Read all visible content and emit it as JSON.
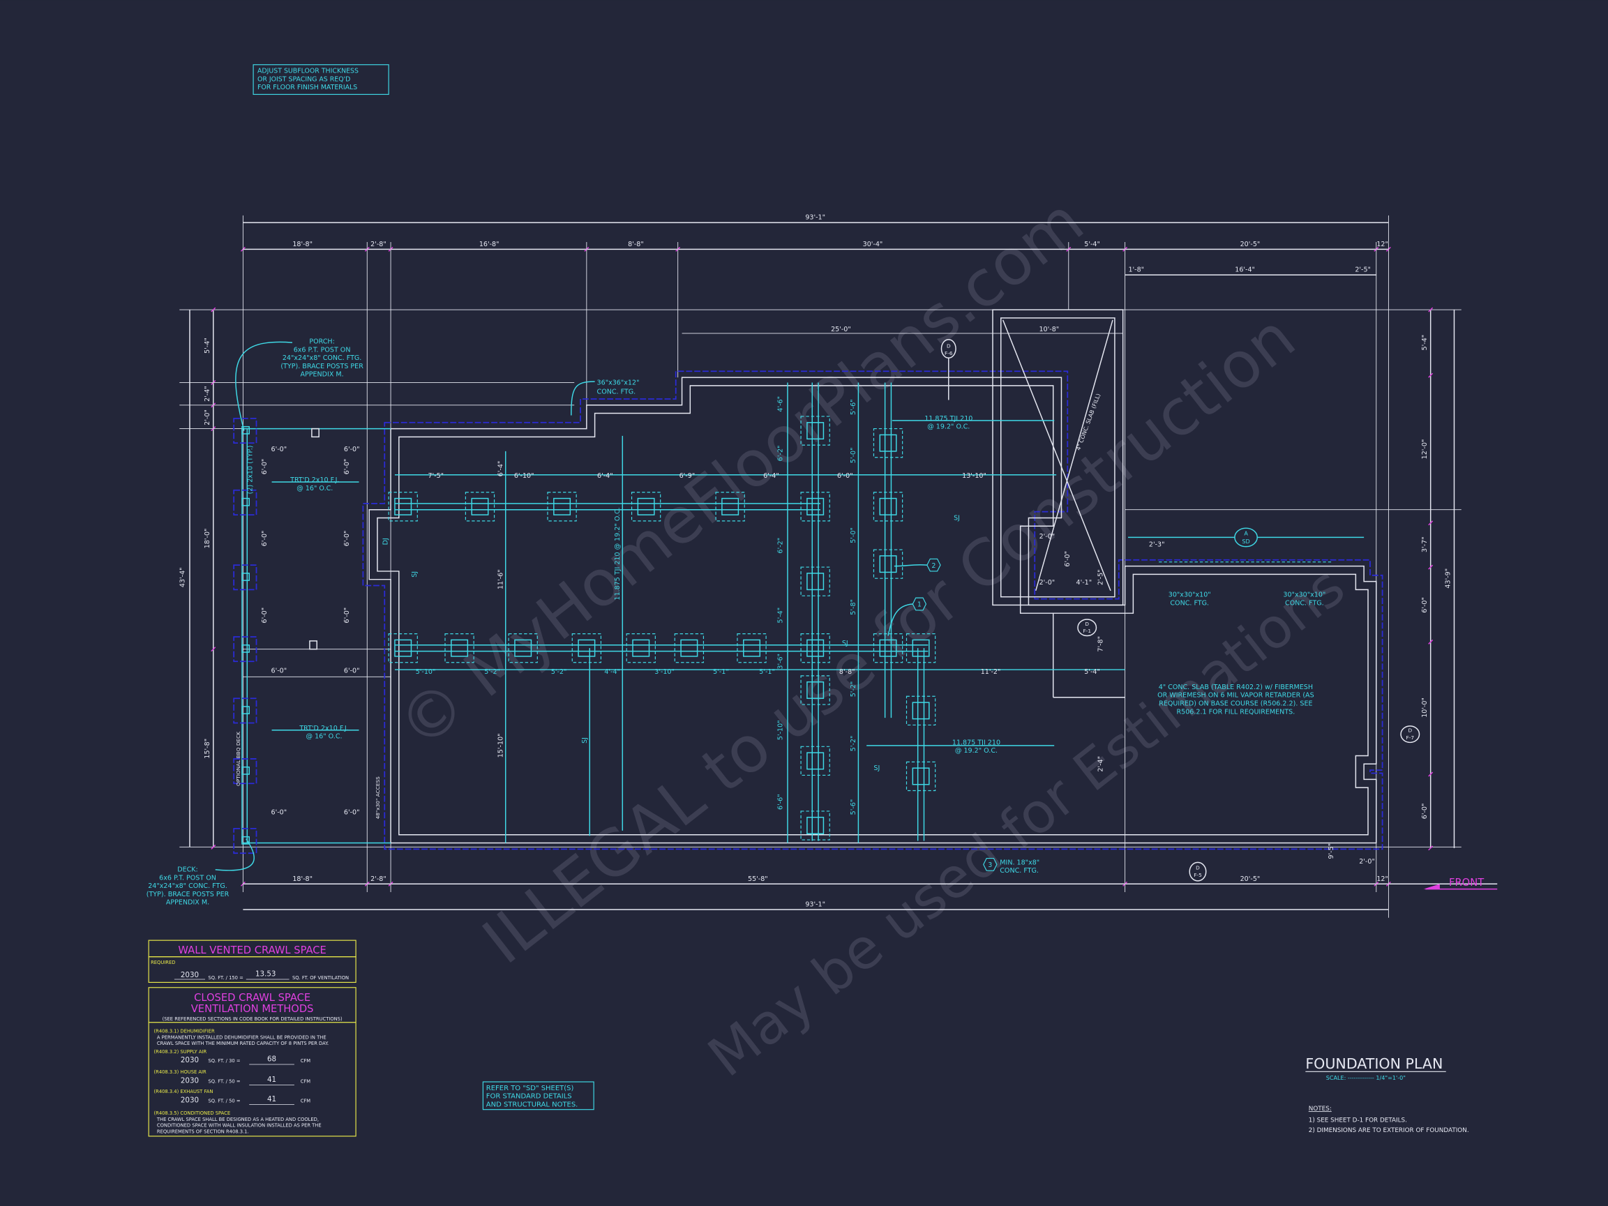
{
  "colors": {
    "background": "#232639",
    "walls": "#e6e8f2",
    "framing": "#3fd9e6",
    "footing_dashed": "#2b2bd6",
    "table_border": "#e8e84a",
    "table_title": "#e040e0",
    "front_arrow": "#e040e0"
  },
  "title": {
    "main": "FOUNDATION PLAN",
    "scale": "SCALE: ------------- 1/4\"=1'-0\""
  },
  "notes": {
    "heading": "NOTES:",
    "items": [
      "1) SEE SHEET D-1 FOR DETAILS.",
      "2) DIMENSIONS ARE TO EXTERIOR OF FOUNDATION."
    ]
  },
  "subfloor_note": [
    "ADJUST SUBFLOOR THICKNESS",
    "OR JOIST SPACING AS REQ'D",
    "FOR FLOOR FINISH MATERIALS"
  ],
  "refer_note": [
    "REFER TO \"SD\" SHEET(S)",
    "FOR STANDARD DETAILS",
    "AND STRUCTURAL NOTES."
  ],
  "porch_note": [
    "PORCH:",
    "6x6 P.T. POST ON",
    "24\"x24\"x8\" CONC. FTG.",
    "(TYP). BRACE POSTS PER",
    "APPENDIX M."
  ],
  "deck_note": [
    "DECK:",
    "6x6 P.T. POST ON",
    "24\"x24\"x8\" CONC. FTG.",
    "(TYP). BRACE POSTS PER",
    "APPENDIX M."
  ],
  "slab_note": [
    "4\" CONC. SLAB (TABLE R402.2) w/ FIBERMESH",
    "OR WIREMESH ON 6 MIL VAPOR RETARDER (AS",
    "REQUIRED) ON BASE COURSE (R506.2.2). SEE",
    "R506.2.1 FOR FILL REQUIREMENTS."
  ],
  "footing_labels": {
    "conc36": [
      "36\"x36\"x12\"",
      "CONC. FTG."
    ],
    "conc30a": [
      "30\"x30\"x10\"",
      "CONC. FTG."
    ],
    "conc30b": [
      "30\"x30\"x10\"",
      "CONC. FTG."
    ],
    "min18": [
      "MIN. 18\"x8\"",
      "CONC. FTG."
    ],
    "min18_tag": "3"
  },
  "framing_labels": {
    "tji_1": [
      "11.875 TJI 210",
      "@ 19.2\" O.C."
    ],
    "tji_2": [
      "11.875 TJI 210",
      "@ 19.2\" O.C."
    ],
    "tji_3": "11.875 TJI 210 @ 19.2\" O.C.",
    "trtd_1": [
      "TRT'D 2x10 F.J.",
      "@ 16\" O.C."
    ],
    "trtd_2": [
      "TRT'D 2x10 F.J.",
      "@ 16\" O.C."
    ],
    "sj": "SJ",
    "dj": "DJ",
    "beam": "(2) 2x10 (TYP.)",
    "bbq": "OPTIONAL BBQ DECK",
    "access": "48\"x30\" ACCESS",
    "slab_fill": "4\" CONC. SLAB (FILL)",
    "callout_1": "1",
    "callout_2": "2"
  },
  "section_markers": {
    "top": [
      "D",
      "F-6"
    ],
    "right": [
      "D",
      "F-7"
    ],
    "mid": [
      "D",
      "F-1"
    ],
    "bottom": [
      "D",
      "F-5"
    ],
    "garage": [
      "A",
      "SD"
    ]
  },
  "front_label": "FRONT",
  "dimensions": {
    "top_overall": "93'-1\"",
    "top_row": [
      "18'-8\"",
      "2'-8\"",
      "16'-8\"",
      "8'-8\"",
      "30'-4\"",
      "5'-4\"",
      "20'-5\"",
      "12\""
    ],
    "top_garage": [
      "1'-8\"",
      "16'-4\"",
      "2'-5\""
    ],
    "bottom_row": [
      "18'-8\"",
      "2'-8\"",
      "55'-8\"",
      "20'-5\"",
      "12\""
    ],
    "bottom_overall": "93'-1\"",
    "left_overall": "43'-4\"",
    "left_row": [
      "5'-4\"",
      "2'-4\"",
      "2'-0\"",
      "18'-0\"",
      "15'-8\""
    ],
    "right_overall": "43'-9\"",
    "right_row": [
      "5'-4\"",
      "12'-0\"",
      "3'-7\"",
      "6'-0\"",
      "10'-0\"",
      "6'-0\""
    ],
    "stair": [
      "25'-0\"",
      "10'-8\""
    ],
    "upper_beam_row": [
      "7'-5\"",
      "6'-10\"",
      "6'-4\"",
      "6'-9\"",
      "6'-4\"",
      "6'-0\"",
      "13'-10\""
    ],
    "lower_beam_row": [
      "5'-10\"",
      "5'-2\"",
      "5'-2\"",
      "4'-4\"",
      "3'-10\"",
      "5'-1\"",
      "5'-1\"",
      "8'-8\"",
      "11'-2\"",
      "5'-4\""
    ],
    "col_a": [
      "4'-6\"",
      "6'-2\"",
      "6'-2\"",
      "5'-4\"",
      "3'-6\"",
      "5'-10\"",
      "6'-6\""
    ],
    "col_b": [
      "5'-6\"",
      "5'-0\"",
      "5'-0\"",
      "5'-8\"",
      "5'-2\"",
      "5'-2\"",
      "5'-6\""
    ],
    "porch": [
      "6'-0\"",
      "6'-0\"",
      "6'-0\"",
      "6'-0\"",
      "6'-0\"",
      "6'-0\""
    ],
    "porch_vert": [
      "6'-0\"",
      "6'-0\"",
      "6'-0\"",
      "6'-0\"",
      "6'-0\"",
      "6'-0\""
    ],
    "misc": [
      "6'-4\"",
      "11'-6\"",
      "15'-10\"",
      "2'-0\"",
      "6'-0\"",
      "2'-0\"",
      "4'-1\"",
      "2'-5\"",
      "2'-3\"",
      "7'-8\"",
      "2'-4\"",
      "2'-0\"",
      "9'-5\""
    ]
  },
  "wall_vented": {
    "title": "WALL VENTED CRAWL SPACE",
    "required": "REQUIRED",
    "area": "2030",
    "formula": "SQ. FT. / 150 =",
    "result": "13.53",
    "unit": "SQ. FT. OF VENTILATION"
  },
  "closed_crawl": {
    "title": [
      "CLOSED CRAWL SPACE",
      "VENTILATION METHODS"
    ],
    "subtitle": "(SEE REFERENCED SECTIONS IN CODE BOOK FOR DETAILED INSTRUCTIONS)",
    "dehumidifier": {
      "label": "(R408.3.1) DEHUMIDIFIER",
      "text": [
        "A PERMANENTLY INSTALLED DEHUMIDIFIER SHALL BE PROVIDED IN THE",
        "CRAWL SPACE WITH THE MINIMUM RATED CAPACITY OF 8 PINTS PER DAY."
      ]
    },
    "supply_air": {
      "label": "(R408.3.2) SUPPLY AIR",
      "area": "2030",
      "formula": "SQ. FT. / 30 =",
      "result": "68",
      "unit": "CFM"
    },
    "house_air": {
      "label": "(R408.3.3) HOUSE AIR",
      "area": "2030",
      "formula": "SQ. FT. / 50 =",
      "result": "41",
      "unit": "CFM"
    },
    "exhaust_fan": {
      "label": "(R408.3.4) EXHAUST FAN",
      "area": "2030",
      "formula": "SQ. FT. / 50 =",
      "result": "41",
      "unit": "CFM"
    },
    "conditioned": {
      "label": "(R408.3.5) CONDITIONED SPACE",
      "text": [
        "THE CRAWL SPACE SHALL BE DESIGNED AS A HEATED AND COOLED,",
        "CONDITIONED SPACE WITH WALL INSULATION INSTALLED AS PER THE",
        "REQUIREMENTS OF SECTION R408.3.1."
      ]
    }
  },
  "watermark": [
    "© MyHomeFloorPlans.com",
    "ILLEGAL to use for Construction",
    "May be used for Estimations"
  ]
}
